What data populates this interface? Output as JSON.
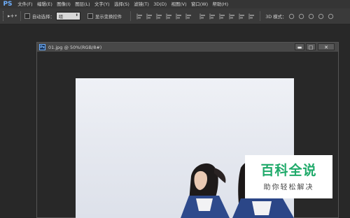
{
  "app": {
    "logo": "PS"
  },
  "menu": {
    "items": [
      "文件(F)",
      "编辑(E)",
      "图像(I)",
      "图层(L)",
      "文字(Y)",
      "选择(S)",
      "滤镜(T)",
      "3D(D)",
      "视图(V)",
      "窗口(W)",
      "帮助(H)"
    ]
  },
  "options_bar": {
    "tool_arrow": "▸+",
    "auto_select_label": "自动选择：",
    "auto_select_value": "组",
    "show_transform_label": "显示变换控件",
    "mode_label": "3D 模式："
  },
  "document": {
    "icon": "Ps",
    "title": "01.jpg @ 50%(RGB/8#)",
    "minimize": "▬",
    "maximize": "□",
    "close": "✕"
  },
  "watermark": {
    "title": "百科全说",
    "subtitle": "助你轻松解决"
  },
  "colors": {
    "accent": "#6fb0ff",
    "watermark_green": "#1faa6a",
    "background": "#282828"
  }
}
